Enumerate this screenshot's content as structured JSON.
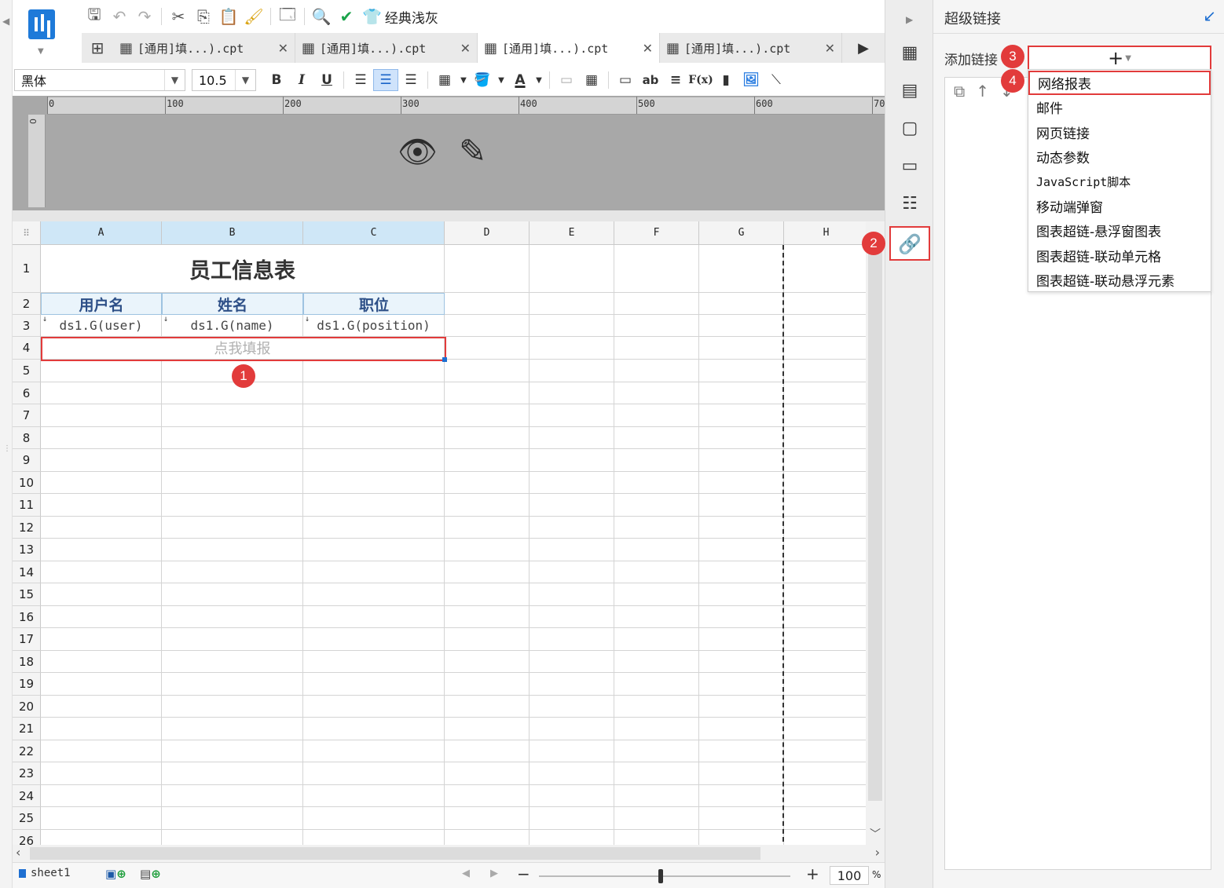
{
  "toolbar": {
    "theme_label": "经典浅灰",
    "icons": [
      "save-icon",
      "undo-icon",
      "redo-icon",
      "cut-icon",
      "copy-icon",
      "paste-icon",
      "format-brush-icon",
      "preview-icon",
      "search-icon",
      "check-icon",
      "theme-icon"
    ]
  },
  "tabs": [
    {
      "label": "[通用]填...).cpt",
      "active": false
    },
    {
      "label": "[通用]填...).cpt",
      "active": false
    },
    {
      "label": "[通用]填...).cpt",
      "active": true
    },
    {
      "label": "[通用]填...).cpt",
      "active": false
    }
  ],
  "format": {
    "font_name": "黑体",
    "font_size": "10.5",
    "bold": "B",
    "italic": "I",
    "underline": "U",
    "text_ab": "ab",
    "formula": "F(x)"
  },
  "ruler": {
    "marks": [
      "0",
      "100",
      "200",
      "300",
      "400",
      "500",
      "600",
      "70"
    ],
    "v_mark": "0"
  },
  "grid": {
    "columns": [
      "A",
      "B",
      "C",
      "D",
      "E",
      "F",
      "G",
      "H"
    ],
    "rows": [
      "1",
      "2",
      "3",
      "4",
      "5",
      "6",
      "7",
      "8",
      "9",
      "10",
      "11",
      "12",
      "13",
      "14",
      "15",
      "16",
      "17",
      "18",
      "19",
      "20",
      "21",
      "22",
      "23",
      "24",
      "25",
      "26"
    ],
    "title": "员工信息表",
    "headers": [
      "用户名",
      "姓名",
      "职位"
    ],
    "fields": [
      "ds1.G(user)",
      "ds1.G(name)",
      "ds1.G(position)"
    ],
    "fill_text": "点我填报"
  },
  "status": {
    "sheet_name": "sheet1",
    "zoom": "100",
    "zoom_unit": "%"
  },
  "panel": {
    "title": "超级链接",
    "add_label": "添加链接",
    "add_symbol": "+",
    "menu": [
      "网络报表",
      "邮件",
      "网页链接",
      "动态参数",
      "JavaScript脚本",
      "移动端弹窗",
      "图表超链-悬浮窗图表",
      "图表超链-联动单元格",
      "图表超链-联动悬浮元素"
    ]
  },
  "steps": [
    "1",
    "2",
    "3",
    "4"
  ],
  "colors": {
    "highlight_red": "#e23b3b",
    "accent_blue": "#1e6fd1",
    "header_fill": "#eaf4fb"
  }
}
